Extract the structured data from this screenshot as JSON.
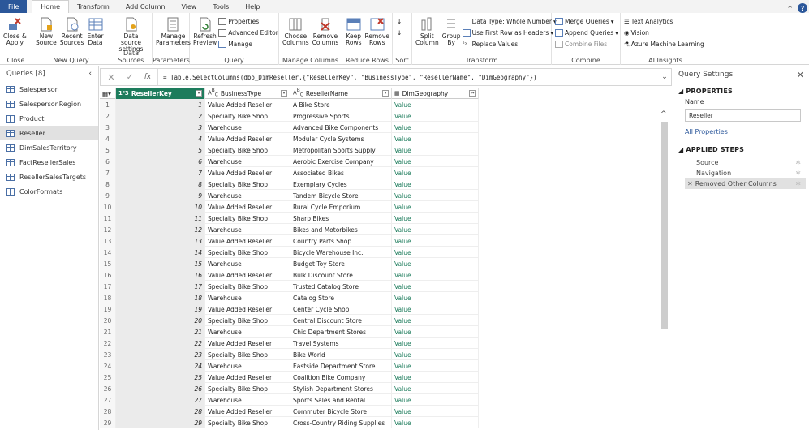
{
  "tabs": [
    "File",
    "Home",
    "Transform",
    "Add Column",
    "View",
    "Tools",
    "Help"
  ],
  "active_tab": "Home",
  "ribbon": {
    "close": {
      "btn1": "Close &",
      "btn1b": "Apply",
      "group": "Close"
    },
    "newquery": {
      "new": "New",
      "new_b": "Source",
      "recent": "Recent",
      "recent_b": "Sources",
      "enter": "Enter",
      "enter_b": "Data",
      "group": "New Query"
    },
    "datasources": {
      "btn": "Data source",
      "btn_b": "settings",
      "group": "Data Sources"
    },
    "parameters": {
      "btn": "Manage",
      "btn_b": "Parameters",
      "group": "Parameters"
    },
    "query": {
      "refresh": "Refresh",
      "refresh_b": "Preview",
      "properties": "Properties",
      "advanced": "Advanced Editor",
      "manage": "Manage",
      "group": "Query"
    },
    "managecols": {
      "choose": "Choose",
      "choose_b": "Columns",
      "remove": "Remove",
      "remove_b": "Columns",
      "group": "Manage Columns"
    },
    "reducerows": {
      "keep": "Keep",
      "keep_b": "Rows",
      "remove": "Remove",
      "remove_b": "Rows",
      "group": "Reduce Rows"
    },
    "sort": {
      "group": "Sort"
    },
    "transform": {
      "split": "Split",
      "split_b": "Column",
      "groupby": "Group",
      "groupby_b": "By",
      "datatype": "Data Type: Whole Number",
      "firstrow": "Use First Row as Headers",
      "replace": "Replace Values",
      "group": "Transform"
    },
    "combine": {
      "merge": "Merge Queries",
      "append": "Append Queries",
      "files": "Combine Files",
      "group": "Combine"
    },
    "ai": {
      "text": "Text Analytics",
      "vision": "Vision",
      "aml": "Azure Machine Learning",
      "group": "AI Insights"
    }
  },
  "queries": {
    "title": "Queries [8]",
    "items": [
      "Salesperson",
      "SalespersonRegion",
      "Product",
      "Reseller",
      "DimSalesTerritory",
      "FactResellerSales",
      "ResellerSalesTargets",
      "ColorFormats"
    ],
    "selected": "Reseller"
  },
  "formula": "= Table.SelectColumns(dbo_DimReseller,{\"ResellerKey\", \"BusinessType\", \"ResellerName\", \"DimGeography\"})",
  "columns": [
    {
      "name": "ResellerKey",
      "type": "1²3"
    },
    {
      "name": "BusinessType",
      "type": "A^B_C"
    },
    {
      "name": "ResellerName",
      "type": "A^B_C"
    },
    {
      "name": "DimGeography",
      "type": "table"
    }
  ],
  "rows": [
    [
      "1",
      "1",
      "Value Added Reseller",
      "A Bike Store",
      "Value"
    ],
    [
      "2",
      "2",
      "Specialty Bike Shop",
      "Progressive Sports",
      "Value"
    ],
    [
      "3",
      "3",
      "Warehouse",
      "Advanced Bike Components",
      "Value"
    ],
    [
      "4",
      "4",
      "Value Added Reseller",
      "Modular Cycle Systems",
      "Value"
    ],
    [
      "5",
      "5",
      "Specialty Bike Shop",
      "Metropolitan Sports Supply",
      "Value"
    ],
    [
      "6",
      "6",
      "Warehouse",
      "Aerobic Exercise Company",
      "Value"
    ],
    [
      "7",
      "7",
      "Value Added Reseller",
      "Associated Bikes",
      "Value"
    ],
    [
      "8",
      "8",
      "Specialty Bike Shop",
      "Exemplary Cycles",
      "Value"
    ],
    [
      "9",
      "9",
      "Warehouse",
      "Tandem Bicycle Store",
      "Value"
    ],
    [
      "10",
      "10",
      "Value Added Reseller",
      "Rural Cycle Emporium",
      "Value"
    ],
    [
      "11",
      "11",
      "Specialty Bike Shop",
      "Sharp Bikes",
      "Value"
    ],
    [
      "12",
      "12",
      "Warehouse",
      "Bikes and Motorbikes",
      "Value"
    ],
    [
      "13",
      "13",
      "Value Added Reseller",
      "Country Parts Shop",
      "Value"
    ],
    [
      "14",
      "14",
      "Specialty Bike Shop",
      "Bicycle Warehouse Inc.",
      "Value"
    ],
    [
      "15",
      "15",
      "Warehouse",
      "Budget Toy Store",
      "Value"
    ],
    [
      "16",
      "16",
      "Value Added Reseller",
      "Bulk Discount Store",
      "Value"
    ],
    [
      "17",
      "17",
      "Specialty Bike Shop",
      "Trusted Catalog Store",
      "Value"
    ],
    [
      "18",
      "18",
      "Warehouse",
      "Catalog Store",
      "Value"
    ],
    [
      "19",
      "19",
      "Value Added Reseller",
      "Center Cycle Shop",
      "Value"
    ],
    [
      "20",
      "20",
      "Specialty Bike Shop",
      "Central Discount Store",
      "Value"
    ],
    [
      "21",
      "21",
      "Warehouse",
      "Chic Department Stores",
      "Value"
    ],
    [
      "22",
      "22",
      "Value Added Reseller",
      "Travel Systems",
      "Value"
    ],
    [
      "23",
      "23",
      "Specialty Bike Shop",
      "Bike World",
      "Value"
    ],
    [
      "24",
      "24",
      "Warehouse",
      "Eastside Department Store",
      "Value"
    ],
    [
      "25",
      "25",
      "Value Added Reseller",
      "Coalition Bike Company",
      "Value"
    ],
    [
      "26",
      "26",
      "Specialty Bike Shop",
      "Stylish Department Stores",
      "Value"
    ],
    [
      "27",
      "27",
      "Warehouse",
      "Sports Sales and Rental",
      "Value"
    ],
    [
      "28",
      "28",
      "Value Added Reseller",
      "Commuter Bicycle Store",
      "Value"
    ],
    [
      "29",
      "29",
      "Specialty Bike Shop",
      "Cross-Country Riding Supplies",
      "Value"
    ]
  ],
  "settings": {
    "title": "Query Settings",
    "properties": "PROPERTIES",
    "name_label": "Name",
    "name_value": "Reseller",
    "all_props": "All Properties",
    "applied": "APPLIED STEPS",
    "steps": [
      "Source",
      "Navigation",
      "Removed Other Columns"
    ]
  },
  "colors": {
    "accent": "#2b579a",
    "selected_col": "#1d7c5c"
  }
}
